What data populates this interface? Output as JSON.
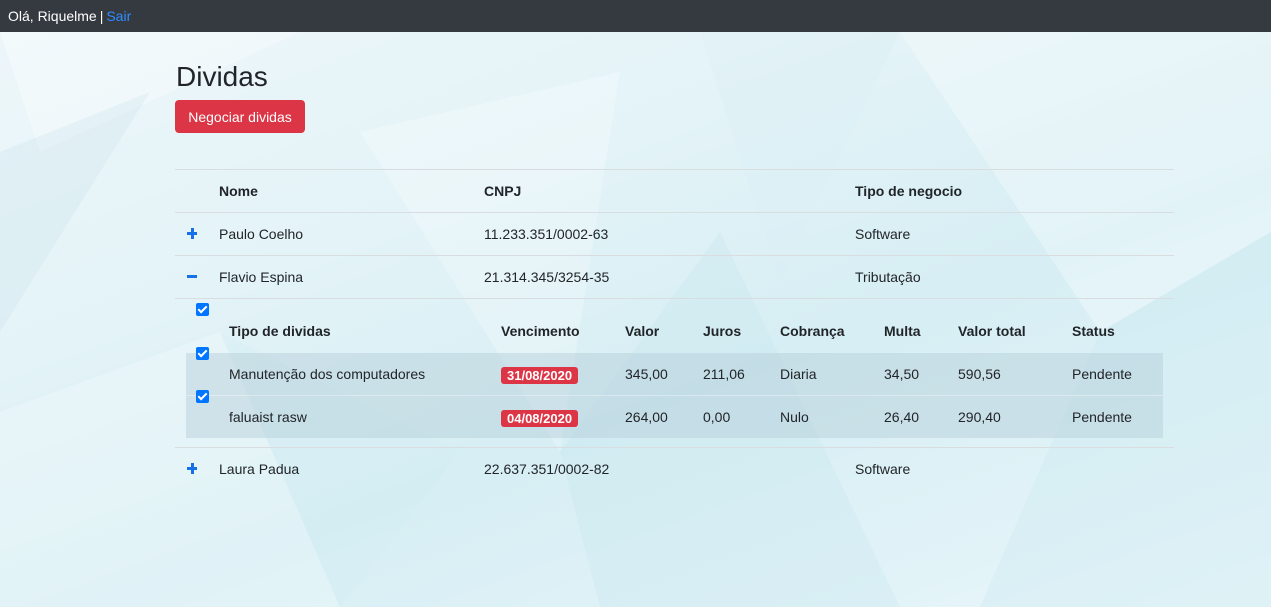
{
  "topbar": {
    "greeting": "Olá, Riquelme",
    "separator": "|",
    "logout_label": "Sair"
  },
  "page": {
    "title": "Dividas",
    "negotiate_button_label": "Negociar dividas"
  },
  "main_table": {
    "headers": {
      "nome": "Nome",
      "cnpj": "CNPJ",
      "tipo": "Tipo de negocio"
    },
    "rows": [
      {
        "toggle": "plus",
        "nome": "Paulo Coelho",
        "cnpj": "11.233.351/0002-63",
        "tipo": "Software",
        "expanded": false
      },
      {
        "toggle": "minus",
        "nome": "Flavio Espina",
        "cnpj": "21.314.345/3254-35",
        "tipo": "Tributação",
        "expanded": true
      },
      {
        "toggle": "plus",
        "nome": "Laura Padua",
        "cnpj": "22.637.351/0002-82",
        "tipo": "Software",
        "expanded": false
      }
    ]
  },
  "debts_table": {
    "headers": {
      "tipo": "Tipo de dividas",
      "vencimento": "Vencimento",
      "valor": "Valor",
      "juros": "Juros",
      "cobranca": "Cobrança",
      "multa": "Multa",
      "valor_total": "Valor total",
      "status": "Status"
    },
    "select_all_checked": true,
    "rows": [
      {
        "checked": true,
        "tipo": "Manutenção dos computadores",
        "vencimento": "31/08/2020",
        "valor": "345,00",
        "juros": "211,06",
        "cobranca": "Diaria",
        "multa": "34,50",
        "valor_total": "590,56",
        "status": "Pendente"
      },
      {
        "checked": true,
        "tipo": "faluaist rasw",
        "vencimento": "04/08/2020",
        "valor": "264,00",
        "juros": "0,00",
        "cobranca": "Nulo",
        "multa": "26,40",
        "valor_total": "290,40",
        "status": "Pendente"
      }
    ]
  },
  "colors": {
    "topbar_bg": "#343a40",
    "link": "#2f8dff",
    "danger": "#dc3545",
    "toggle_icon": "#1670e8",
    "checkbox": "#0075ff"
  }
}
